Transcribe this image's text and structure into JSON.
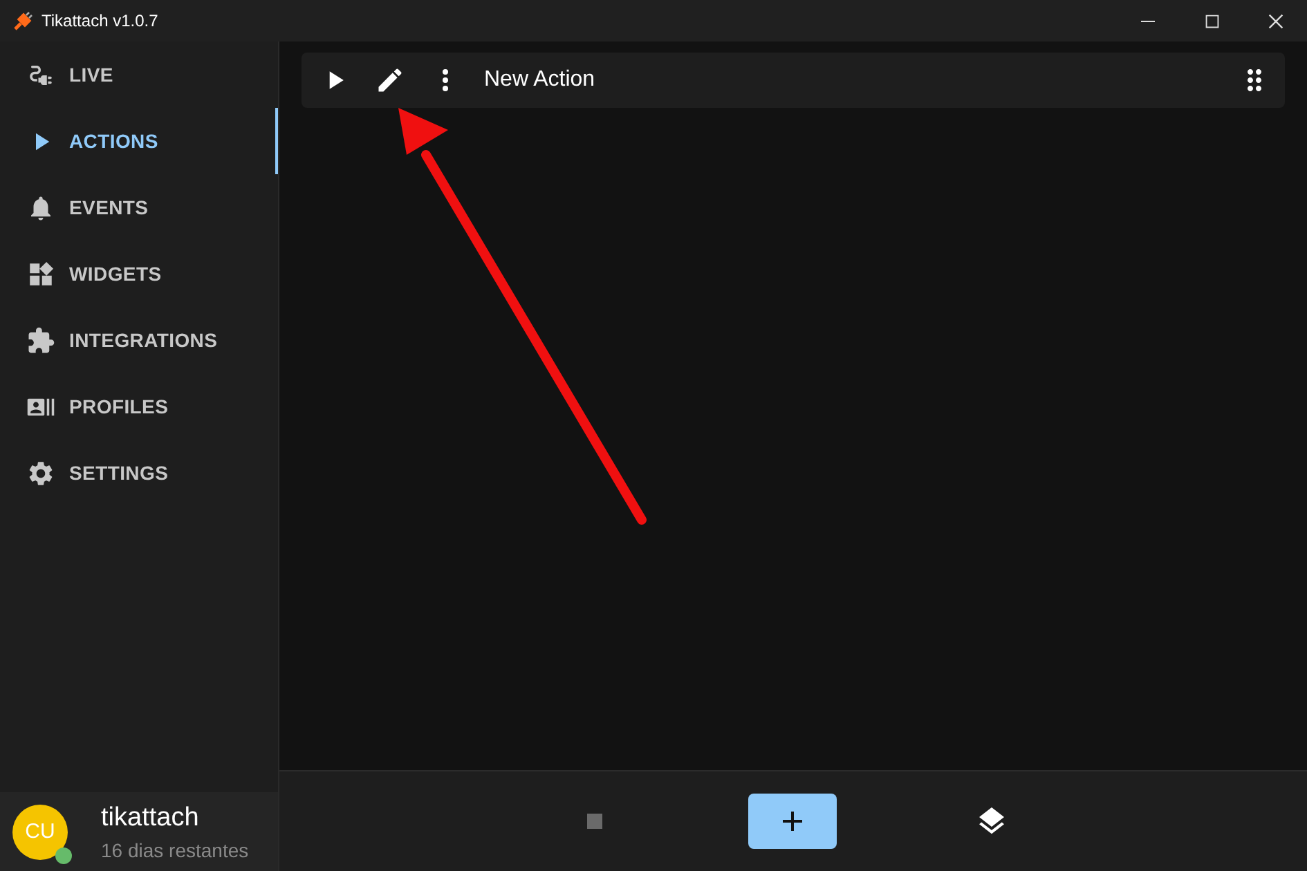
{
  "window": {
    "title": "Tikattach v1.0.7"
  },
  "nav": [
    {
      "kind": "live",
      "label": "LIVE",
      "selected": false
    },
    {
      "kind": "actions",
      "label": "ACTIONS",
      "selected": true
    },
    {
      "kind": "events",
      "label": "EVENTS",
      "selected": false
    },
    {
      "kind": "widgets",
      "label": "WIDGETS",
      "selected": false
    },
    {
      "kind": "integrations",
      "label": "INTEGRATIONS",
      "selected": false
    },
    {
      "kind": "profiles",
      "label": "PROFILES",
      "selected": false
    },
    {
      "kind": "settings",
      "label": "SETTINGS",
      "selected": false
    }
  ],
  "actions": [
    {
      "name": "New Action"
    }
  ],
  "user": {
    "initials": "CU",
    "name": "tikattach",
    "subtitle": "16 dias restantes",
    "online": true
  }
}
